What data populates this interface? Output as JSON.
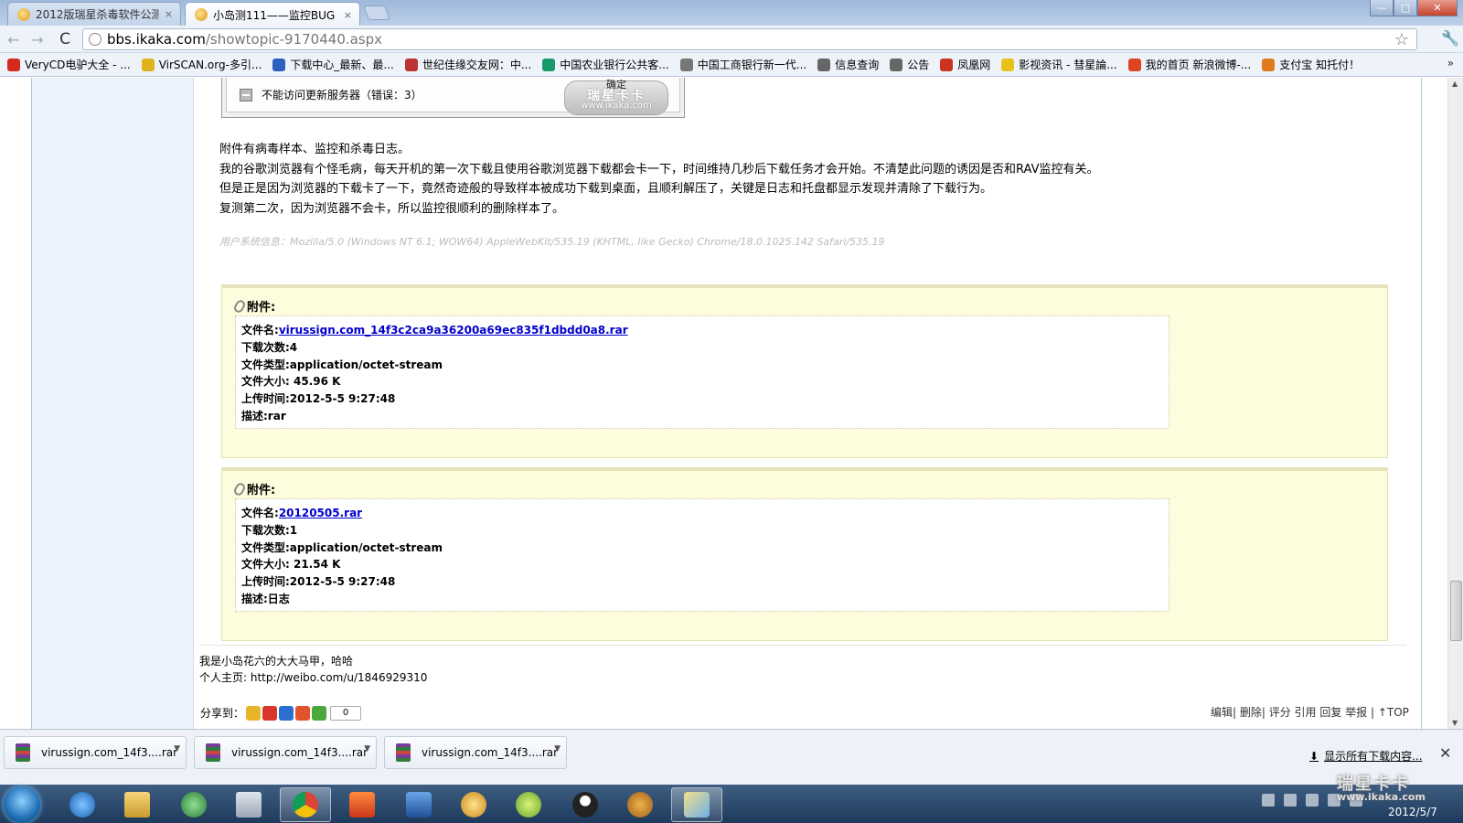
{
  "tabs": [
    {
      "title": "2012版瑞星杀毒软件公测专",
      "close": "×"
    },
    {
      "title": "小岛测111——监控BUG -",
      "close": "×"
    }
  ],
  "window_controls": {
    "minimize": "—",
    "maximize": "□",
    "close": "✕"
  },
  "toolbar": {
    "back": "←",
    "forward": "→",
    "reload": "C",
    "star": "☆",
    "wrench": "🔧"
  },
  "url": {
    "host": "bbs.ikaka.com",
    "path": "/showtopic-9170440.aspx"
  },
  "bookmarks": [
    {
      "label": "VeryCD电驴大全 - ...",
      "color": "#d4291f"
    },
    {
      "label": "VirSCAN.org-多引...",
      "color": "#e0b21c"
    },
    {
      "label": "下载中心_最新、最...",
      "color": "#2d5fbf"
    },
    {
      "label": "世纪佳缘交友网：中...",
      "color": "#b33"
    },
    {
      "label": "中国农业银行公共客...",
      "color": "#1a9a6c"
    },
    {
      "label": "中国工商银行新一代...",
      "color": "#777"
    },
    {
      "label": "信息查询",
      "color": "#666"
    },
    {
      "label": "公告",
      "color": "#666"
    },
    {
      "label": "凤凰网",
      "color": "#c32"
    },
    {
      "label": "影视资讯 - 彗星論...",
      "color": "#e8c21c"
    },
    {
      "label": "我的首页 新浪微博-...",
      "color": "#d42"
    },
    {
      "label": "支付宝 知托付！",
      "color": "#e07a1c"
    }
  ],
  "bookmarks_more": "»",
  "screenshot_dialog": {
    "message": "不能访问更新服务器（错误：3）",
    "ok_label": "确定",
    "watermark": "瑞星卡卡",
    "watermark_url": "www.ikaka.com"
  },
  "post": {
    "lines": [
      "附件有病毒样本、监控和杀毒日志。",
      "我的谷歌浏览器有个怪毛病，每天开机的第一次下载且使用谷歌浏览器下载都会卡一下，时间维持几秒后下载任务才会开始。不清楚此问题的诱因是否和RAV监控有关。",
      "但是正是因为浏览器的下载卡了一下，竟然奇迹般的导致样本被成功下载到桌面，且顺利解压了，关键是日志和托盘都显示发现并清除了下载行为。",
      "复测第二次，因为浏览器不会卡，所以监控很顺利的删除样本了。"
    ],
    "system_info": "用户系统信息：Mozilla/5.0 (Windows NT 6.1; WOW64) AppleWebKit/535.19 (KHTML, like Gecko) Chrome/18.0.1025.142 Safari/535.19"
  },
  "attachments": [
    {
      "header": "附件:",
      "filename_label": "文件名:",
      "filename": "virussign.com_14f3c2ca9a36200a69ec835f1dbdd0a8.rar",
      "downloads": "下载次数:4",
      "type": "文件类型:application/octet-stream",
      "size": "文件大小: 45.96 K",
      "uploaded": "上传时间:2012-5-5 9:27:48",
      "desc": "描述:rar"
    },
    {
      "header": "附件:",
      "filename_label": "文件名:",
      "filename": "20120505.rar",
      "downloads": "下载次数:1",
      "type": "文件类型:application/octet-stream",
      "size": "文件大小: 21.54 K",
      "uploaded": "上传时间:2012-5-5 9:27:48",
      "desc": "描述:日志"
    }
  ],
  "signature": {
    "line1": "我是小岛花六的大大马甲，哈哈",
    "line2": "个人主页: http://weibo.com/u/1846929310"
  },
  "share": {
    "label": "分享到：",
    "count": "0"
  },
  "actions": "编辑| 删除| 评分 引用 回复 举报 | ↑TOP",
  "downloads_shelf": {
    "items": [
      "virussign.com_14f3....rar",
      "virussign.com_14f3....rar",
      "virussign.com_14f3....rar"
    ],
    "show_all": "显示所有下载内容...",
    "close": "✕"
  },
  "taskbar": {
    "watermark": "瑞星卡卡",
    "watermark_url": "www.ikaka.com",
    "time": "",
    "date": "2012/5/7"
  }
}
